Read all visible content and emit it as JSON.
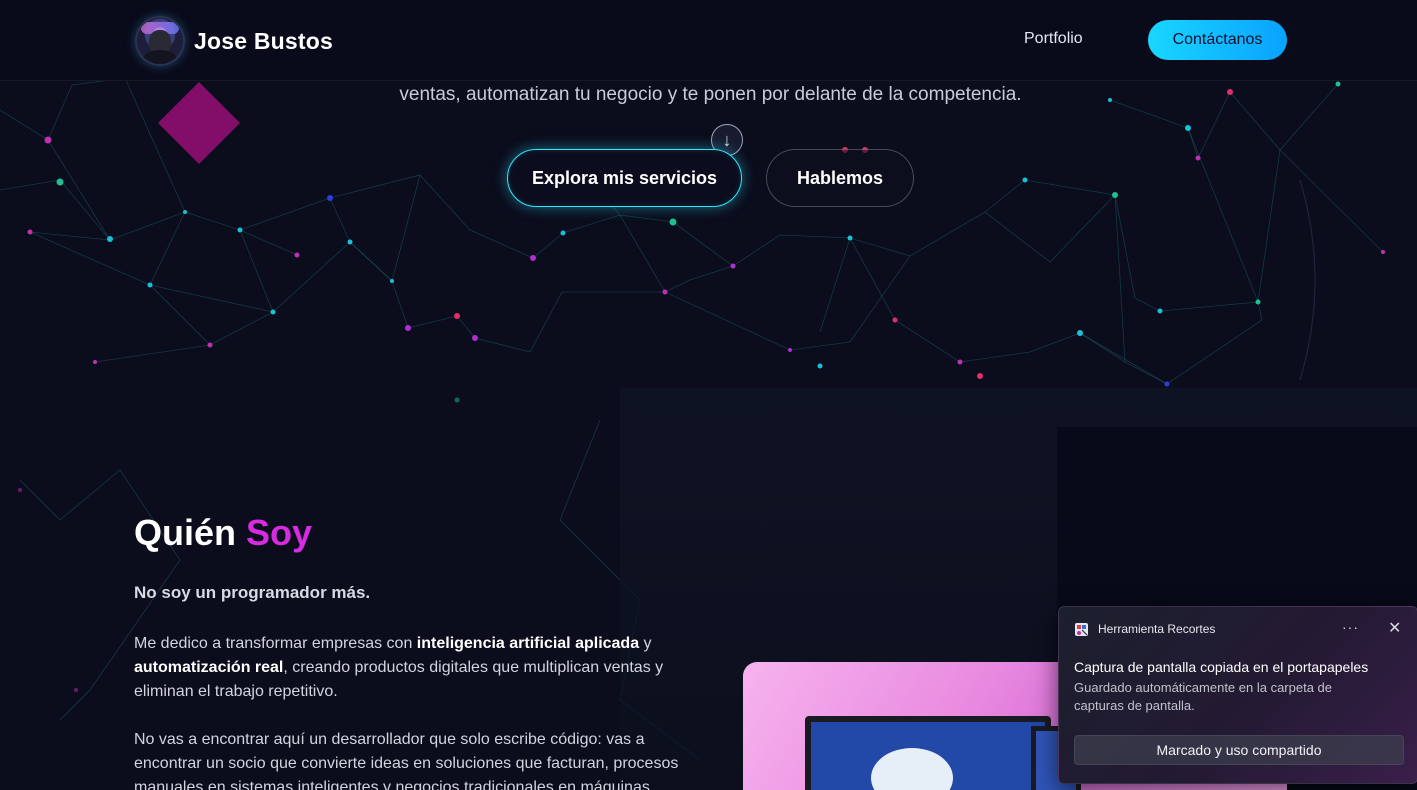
{
  "navbar": {
    "brand_name": "Jose Bustos",
    "links": [
      {
        "label": "Portfolio"
      }
    ],
    "cta_label": "Contáctanos"
  },
  "hero": {
    "subtitle": "ventas, automatizan tu negocio y te ponen por delante de la competencia.",
    "primary_button": "Explora mis servicios",
    "secondary_button": "Hablemos",
    "scroll_icon": "arrow-down-icon"
  },
  "about": {
    "title_main": "Quién ",
    "title_accent": "Soy",
    "lead": "No soy un programador más.",
    "para1_a": "Me dedico a transformar empresas con ",
    "para1_b": "inteligencia artificial aplicada",
    "para1_c": " y ",
    "para1_d": "automatización real",
    "para1_e": ", creando productos digitales que multiplican ventas y eliminan el trabajo repetitivo.",
    "para2": "No vas a encontrar aquí un desarrollador que solo escribe código: vas a encontrar un socio que convierte ideas en soluciones que facturan, procesos manuales en sistemas inteligentes y negocios tradicionales en máquinas"
  },
  "toast": {
    "app_name": "Herramienta Recortes",
    "more_label": "···",
    "close_label": "✕",
    "title": "Captura de pantalla copiada en el portapapeles",
    "body": "Guardado automáticamente en la carpeta de capturas de pantalla.",
    "button_label": "Marcado y uso compartido"
  },
  "colors": {
    "accent_cyan": "#19d6ff",
    "accent_magenta": "#d62be0",
    "background": "#0b0c1c"
  }
}
